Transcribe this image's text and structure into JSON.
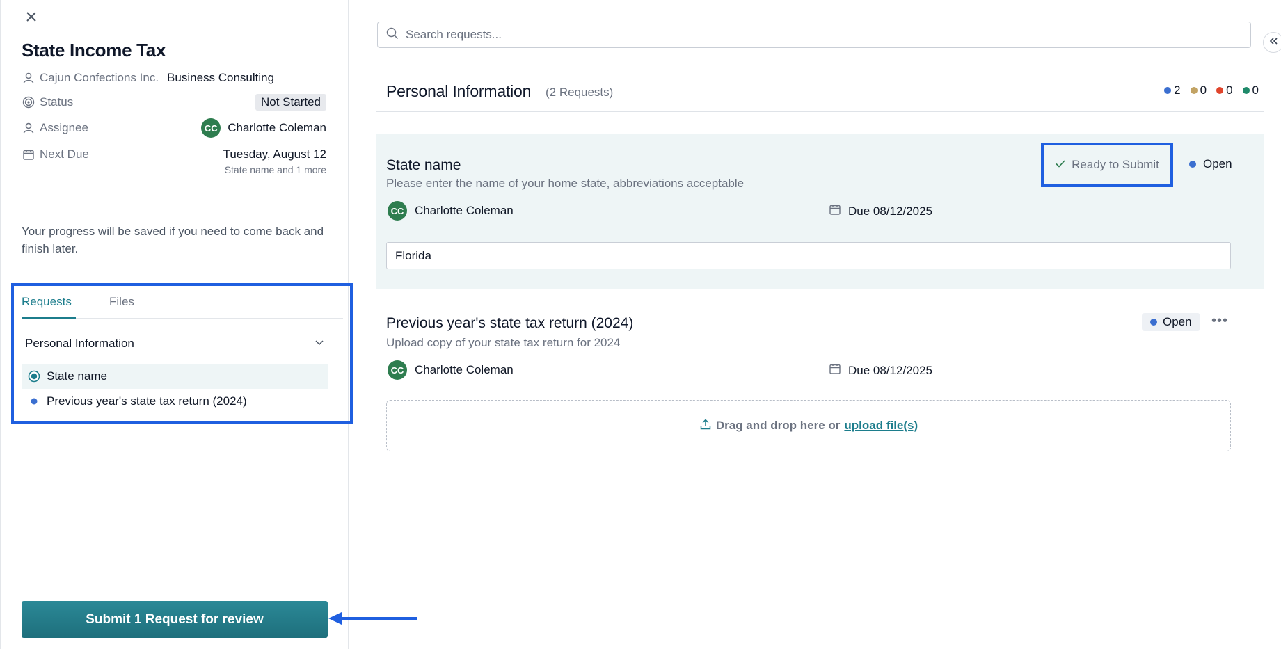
{
  "panel": {
    "title": "State Income Tax",
    "client": "Cajun Confections Inc.",
    "service": "Business Consulting",
    "status_label": "Status",
    "status_value": "Not Started",
    "assignee_label": "Assignee",
    "assignee_initials": "CC",
    "assignee_name": "Charlotte Coleman",
    "next_due_label": "Next Due",
    "next_due_value": "Tuesday, August 12",
    "next_due_sub": "State name and 1 more",
    "progress_note": "Your progress will be saved if you need to come back and finish later.",
    "tabs": [
      {
        "label": "Requests"
      },
      {
        "label": "Files"
      }
    ],
    "group_label": "Personal Information",
    "items": [
      {
        "label": "State name"
      },
      {
        "label": "Previous year's state tax return (2024)"
      }
    ],
    "submit_label": "Submit 1 Request for review"
  },
  "main": {
    "search_placeholder": "Search requests...",
    "section_title": "Personal Information",
    "section_count": "(2 Requests)",
    "counts": [
      {
        "value": "2",
        "color": "#3b6fd0"
      },
      {
        "value": "0",
        "color": "#c2a364"
      },
      {
        "value": "0",
        "color": "#e0452c"
      },
      {
        "value": "0",
        "color": "#1f8a6a"
      }
    ],
    "requests": [
      {
        "title": "State name",
        "description": "Please enter the name of your home state, abbreviations acceptable",
        "assignee_initials": "CC",
        "assignee": "Charlotte Coleman",
        "due": "Due 08/12/2025",
        "ready_label": "Ready to Submit",
        "status": "Open",
        "input_value": "Florida"
      },
      {
        "title": "Previous year's state tax return (2024)",
        "description": "Upload copy of your state tax return for 2024",
        "assignee_initials": "CC",
        "assignee": "Charlotte Coleman",
        "due": "Due 08/12/2025",
        "status": "Open",
        "drop_text": "Drag and drop here or",
        "upload_link": "upload file(s)"
      }
    ]
  },
  "colors": {
    "accent": "#1c7d8c",
    "highlight": "#1f5fe0",
    "avatar": "#2e7d4f",
    "open_dot": "#3b6fd0"
  }
}
